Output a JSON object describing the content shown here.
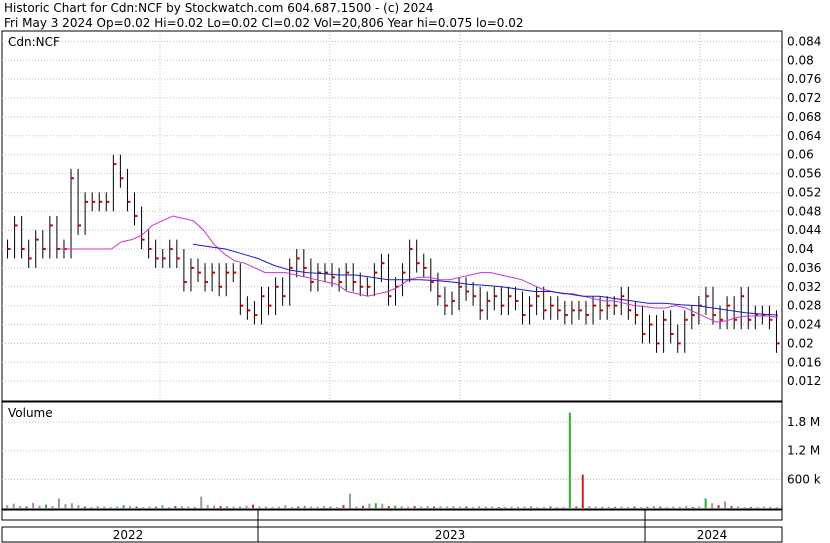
{
  "header": {
    "line1": "Historic Chart for Cdn:NCF by Stockwatch.com 604.687.1500 - (c) 2024",
    "line2": "Fri May  3 2024   Op=0.02  Hi=0.02  Lo=0.02  Cl=0.02  Vol=20,806  Year hi=0.075  lo=0.02"
  },
  "colors": {
    "background": "#ffffff",
    "bar": "#000000",
    "close_tick": "#cc0000",
    "ma_short": "#cc33cc",
    "ma_long": "#1a1acc",
    "vol_up": "#33aa33",
    "vol_down": "#cc2222",
    "vol_flat": "#999999"
  },
  "chart_data": [
    {
      "type": "ohlc",
      "title": "Cdn:NCF",
      "ylim": [
        0.008,
        0.086
      ],
      "y_ticks": [
        "0.084",
        "0.08",
        "0.076",
        "0.072",
        "0.068",
        "0.064",
        "0.06",
        "0.056",
        "0.052",
        "0.048",
        "0.044",
        "0.04",
        "0.036",
        "0.032",
        "0.028",
        "0.024",
        "0.02",
        "0.016",
        "0.012"
      ],
      "x_periods": [
        "2022",
        "2023",
        "2024"
      ],
      "grid": true,
      "series": [
        {
          "key": "price",
          "values": [
            0.04,
            0.045,
            0.04,
            0.038,
            0.042,
            0.04,
            0.045,
            0.04,
            0.04,
            0.055,
            0.045,
            0.05,
            0.05,
            0.05,
            0.05,
            0.058,
            0.055,
            0.05,
            0.047,
            0.042,
            0.04,
            0.038,
            0.038,
            0.04,
            0.038,
            0.033,
            0.036,
            0.035,
            0.033,
            0.035,
            0.032,
            0.035,
            0.035,
            0.028,
            0.027,
            0.026,
            0.03,
            0.028,
            0.032,
            0.03,
            0.036,
            0.038,
            0.036,
            0.033,
            0.035,
            0.035,
            0.034,
            0.033,
            0.035,
            0.033,
            0.032,
            0.032,
            0.035,
            0.037,
            0.03,
            0.032,
            0.035,
            0.04,
            0.037,
            0.036,
            0.033,
            0.03,
            0.028,
            0.029,
            0.032,
            0.031,
            0.03,
            0.027,
            0.029,
            0.03,
            0.028,
            0.03,
            0.029,
            0.026,
            0.028,
            0.03,
            0.027,
            0.028,
            0.027,
            0.026,
            0.027,
            0.027,
            0.026,
            0.028,
            0.027,
            0.028,
            0.028,
            0.03,
            0.027,
            0.026,
            0.022,
            0.024,
            0.02,
            0.025,
            0.022,
            0.02,
            0.025,
            0.026,
            0.028,
            0.03,
            0.026,
            0.025,
            0.028,
            0.025,
            0.03,
            0.025,
            0.026,
            0.026,
            0.025,
            0.02
          ]
        },
        {
          "key": "ma_short",
          "values": [
            0.04,
            0.04,
            0.04,
            0.04,
            0.04,
            0.04,
            0.0415,
            0.042,
            0.043,
            0.045,
            0.046,
            0.047,
            0.0465,
            0.046,
            0.044,
            0.041,
            0.039,
            0.0375,
            0.037,
            0.036,
            0.035,
            0.035,
            0.035,
            0.0345,
            0.034,
            0.0335,
            0.033,
            0.0325,
            0.031,
            0.0305,
            0.03,
            0.0305,
            0.031,
            0.032,
            0.0335,
            0.034,
            0.034,
            0.0335,
            0.0335,
            0.034,
            0.0345,
            0.035,
            0.035,
            0.0345,
            0.034,
            0.0335,
            0.0325,
            0.0315,
            0.031,
            0.0305,
            0.0305,
            0.03,
            0.0295,
            0.029,
            0.029,
            0.0285,
            0.028,
            0.0278,
            0.0275,
            0.0275,
            0.028,
            0.0275,
            0.0265,
            0.0255,
            0.0245,
            0.0248,
            0.0255,
            0.0258,
            0.0258,
            0.0258,
            0.0255
          ]
        },
        {
          "key": "ma_long",
          "values": [
            0.041,
            0.0405,
            0.04,
            0.039,
            0.038,
            0.0365,
            0.0355,
            0.035,
            0.0348,
            0.0345,
            0.0345,
            0.034,
            0.0335,
            0.0335,
            0.0335,
            0.0333,
            0.033,
            0.0325,
            0.0323,
            0.032,
            0.0315,
            0.031,
            0.031,
            0.0305,
            0.03,
            0.03,
            0.0295,
            0.029,
            0.0285,
            0.0285,
            0.0282,
            0.028,
            0.0275,
            0.027,
            0.0265,
            0.0262,
            0.026
          ]
        }
      ]
    },
    {
      "type": "bar",
      "title": "Volume",
      "ylim": [
        0,
        2200000
      ],
      "y_ticks": [
        "1.8 M",
        "1.2 M",
        "600 k"
      ],
      "values": [
        60000,
        90000,
        40000,
        30000,
        110000,
        50000,
        70000,
        40000,
        200000,
        80000,
        100000,
        60000,
        30000,
        20000,
        40000,
        30000,
        20000,
        30000,
        60000,
        40000,
        30000,
        20000,
        30000,
        30000,
        60000,
        20000,
        40000,
        40000,
        30000,
        20000,
        240000,
        60000,
        50000,
        40000,
        40000,
        30000,
        30000,
        50000,
        70000,
        30000,
        30000,
        20000,
        30000,
        60000,
        20000,
        30000,
        40000,
        30000,
        30000,
        40000,
        30000,
        20000,
        60000,
        300000,
        30000,
        50000,
        90000,
        100000,
        90000,
        40000,
        50000,
        40000,
        30000,
        40000,
        30000,
        40000,
        30000,
        40000,
        30000,
        40000,
        30000,
        30000,
        20000,
        40000,
        30000,
        30000,
        20000,
        20000,
        30000,
        20000,
        30000,
        40000,
        20000,
        20000,
        30000,
        20000,
        20000,
        2000000,
        30000,
        700000,
        40000,
        30000,
        20000,
        30000,
        20000,
        30000,
        20000,
        30000,
        20000,
        30000,
        40000,
        30000,
        20000,
        30000,
        20000,
        40000,
        20000,
        30000,
        200000,
        100000,
        60000,
        140000,
        40000,
        30000,
        20000,
        20000,
        20000,
        30000,
        20000,
        20000
      ],
      "value_colors": [
        "flat",
        "flat",
        "flat",
        "down",
        "flat",
        "flat",
        "up",
        "flat",
        "flat",
        "flat",
        "flat",
        "flat",
        "down",
        "flat",
        "flat",
        "flat",
        "flat",
        "flat",
        "up",
        "flat",
        "down",
        "flat",
        "flat",
        "up",
        "flat",
        "flat",
        "down",
        "flat",
        "flat",
        "up",
        "flat",
        "flat",
        "flat",
        "down",
        "flat",
        "flat",
        "up",
        "flat",
        "down",
        "flat",
        "flat",
        "flat",
        "flat",
        "flat",
        "flat",
        "down",
        "up",
        "flat",
        "flat",
        "flat",
        "up",
        "flat",
        "down",
        "flat",
        "flat",
        "down",
        "flat",
        "up",
        "flat",
        "down",
        "up",
        "flat",
        "flat",
        "down",
        "flat",
        "flat",
        "down",
        "flat",
        "flat",
        "flat",
        "flat",
        "down",
        "flat",
        "flat",
        "flat",
        "flat",
        "down",
        "flat",
        "flat",
        "up",
        "flat",
        "flat",
        "flat",
        "flat",
        "down",
        "flat",
        "flat",
        "up",
        "down",
        "down",
        "flat",
        "flat",
        "up",
        "flat",
        "down",
        "flat",
        "flat",
        "down",
        "flat",
        "up",
        "flat",
        "down",
        "flat",
        "flat",
        "up",
        "flat",
        "down",
        "flat",
        "up",
        "flat",
        "down",
        "flat",
        "down",
        "flat",
        "flat",
        "down",
        "flat",
        "flat",
        "up",
        "flat",
        "flat"
      ]
    }
  ]
}
